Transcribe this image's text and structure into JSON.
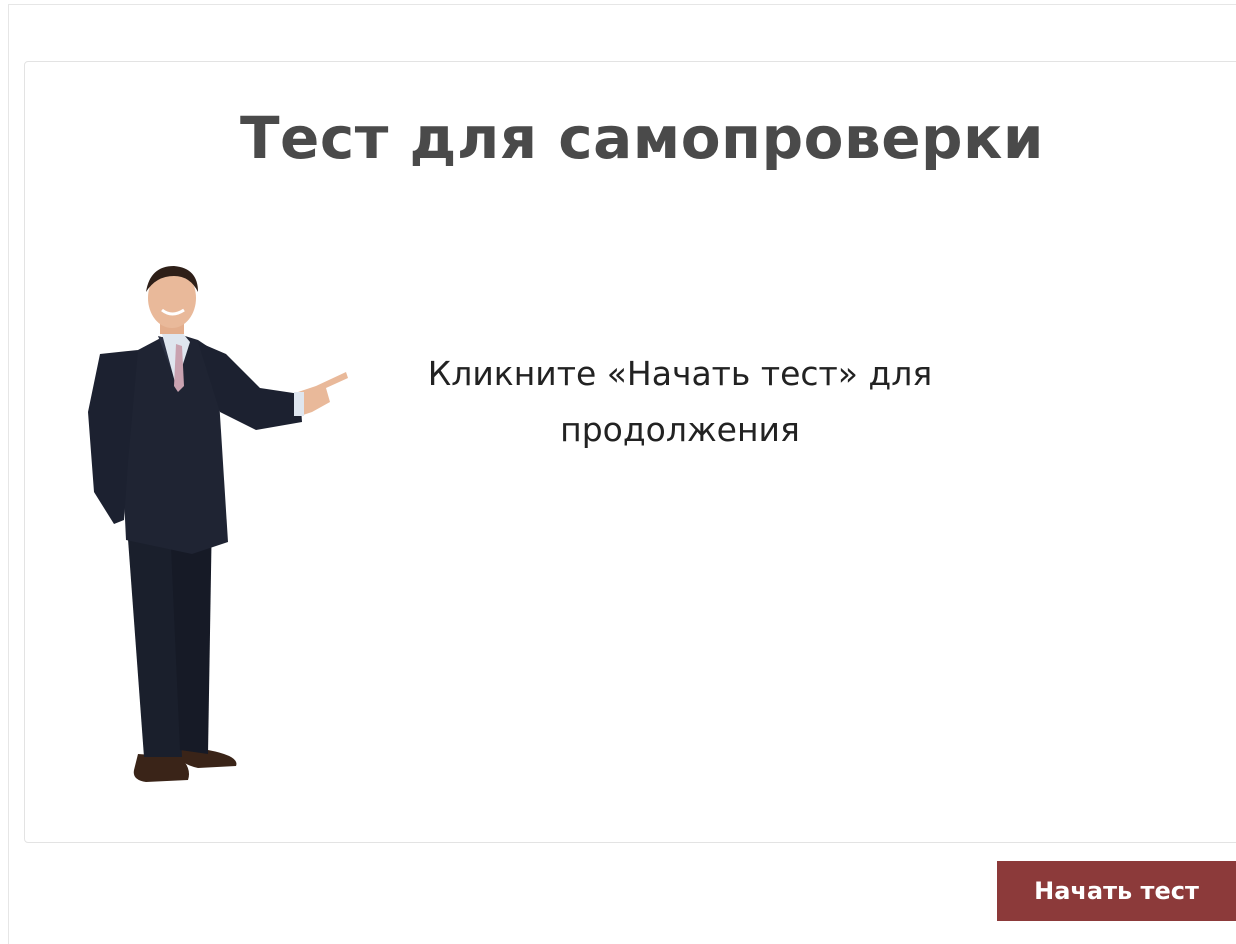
{
  "slide": {
    "title": "Тест для самопроверки",
    "instruction": "Кликните «Начать тест» для продолжения"
  },
  "footer": {
    "start_label": "Начать тест"
  },
  "colors": {
    "accent": "#8c3a3a",
    "title": "#4a4a4a",
    "text": "#222222",
    "border": "#e3e3e3"
  },
  "icons": {
    "presenter": "businessman-pointing-illustration"
  }
}
